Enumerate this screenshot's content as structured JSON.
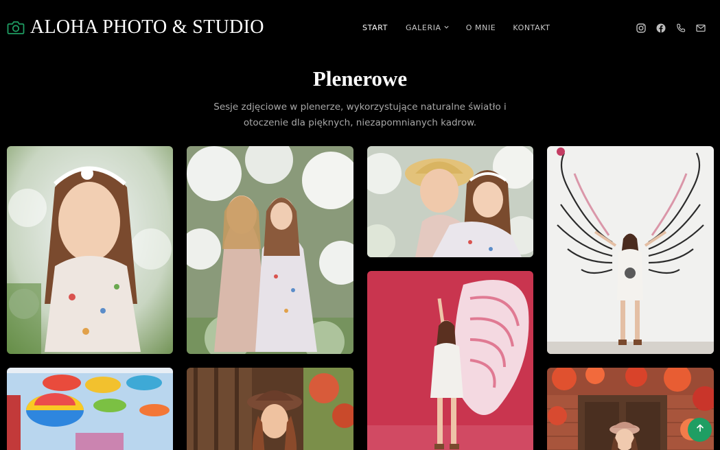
{
  "brand": {
    "name": "ALOHA PHOTO & STUDIO",
    "icon": "camera-icon",
    "accent": "#1f9e63"
  },
  "nav": {
    "items": [
      {
        "label": "START",
        "active": true
      },
      {
        "label": "GALERIA",
        "has_dropdown": true
      },
      {
        "label": "O MNIE"
      },
      {
        "label": "KONTAKT"
      }
    ]
  },
  "socials": [
    "instagram-icon",
    "facebook-icon",
    "phone-icon",
    "envelope-icon"
  ],
  "section": {
    "title": "Plenerowe",
    "description": "Sesje zdjęciowe w plenerze, wykorzystujące naturalne światło i otoczenie dla pięknych, niezapomnianych kadrow."
  },
  "gallery": {
    "photos": [
      {
        "subject": "girl with flower crown among blossoms"
      },
      {
        "subject": "mother and daughter among white blossoms"
      },
      {
        "subject": "mother in straw hat hugging daughter"
      },
      {
        "subject": "woman posing in front of black wings mural"
      },
      {
        "subject": "woman in front of pink wings mural"
      },
      {
        "subject": "colorful umbrellas street"
      },
      {
        "subject": "woman in hat by wooden door"
      },
      {
        "subject": "woman in hat by red ivy brick wall"
      }
    ]
  },
  "back_to_top": {
    "icon": "arrow-up-icon"
  }
}
